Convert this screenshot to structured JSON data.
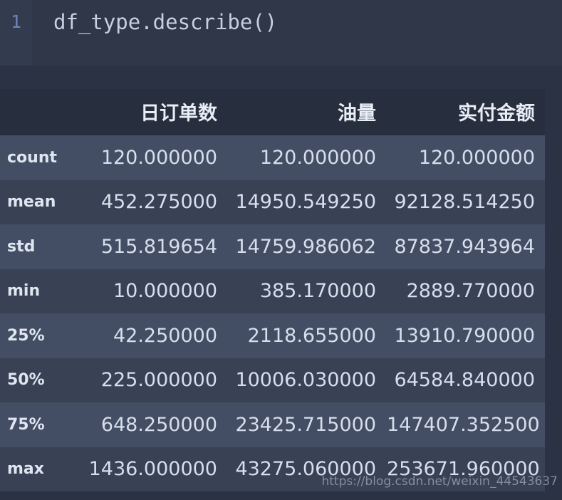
{
  "code_cell": {
    "line_number": "1",
    "code": "df_type.describe()"
  },
  "colors": {
    "page_background": "#2b3243",
    "code_background": "#2f3748",
    "gutter_background": "#333c4f",
    "line_number": "#6d84b4",
    "code_text": "#c7d0e0",
    "header_background": "#272e3d",
    "row_odd_background": "#434e64",
    "row_even_background": "#394254",
    "text": "#d7deec",
    "watermark": "#9aa4b6"
  },
  "table": {
    "index_header": "",
    "columns": [
      "日订单数",
      "油量",
      "实付金额"
    ],
    "rows": [
      {
        "index": "count",
        "values": [
          "120.000000",
          "120.000000",
          "120.000000"
        ]
      },
      {
        "index": "mean",
        "values": [
          "452.275000",
          "14950.549250",
          "92128.514250"
        ]
      },
      {
        "index": "std",
        "values": [
          "515.819654",
          "14759.986062",
          "87837.943964"
        ]
      },
      {
        "index": "min",
        "values": [
          "10.000000",
          "385.170000",
          "2889.770000"
        ]
      },
      {
        "index": "25%",
        "values": [
          "42.250000",
          "2118.655000",
          "13910.790000"
        ]
      },
      {
        "index": "50%",
        "values": [
          "225.000000",
          "10006.030000",
          "64584.840000"
        ]
      },
      {
        "index": "75%",
        "values": [
          "648.250000",
          "23425.715000",
          "147407.352500"
        ]
      },
      {
        "index": "max",
        "values": [
          "1436.000000",
          "43275.060000",
          "253671.960000"
        ]
      }
    ]
  },
  "watermark": {
    "text": "https://blog.csdn.net/weixin_44543637"
  },
  "chart_data": {
    "type": "table",
    "title": "df_type.describe()",
    "columns": [
      "日订单数",
      "油量",
      "实付金额"
    ],
    "index": [
      "count",
      "mean",
      "std",
      "min",
      "25%",
      "50%",
      "75%",
      "max"
    ],
    "series": [
      {
        "name": "日订单数",
        "values": [
          120.0,
          452.275,
          515.819654,
          10.0,
          42.25,
          225.0,
          648.25,
          1436.0
        ]
      },
      {
        "name": "油量",
        "values": [
          120.0,
          14950.54925,
          14759.986062,
          385.17,
          2118.655,
          10006.03,
          23425.715,
          43275.06
        ]
      },
      {
        "name": "实付金额",
        "values": [
          120.0,
          92128.51425,
          87837.943964,
          2889.77,
          13910.79,
          64584.84,
          147407.3525,
          253671.96
        ]
      }
    ]
  }
}
